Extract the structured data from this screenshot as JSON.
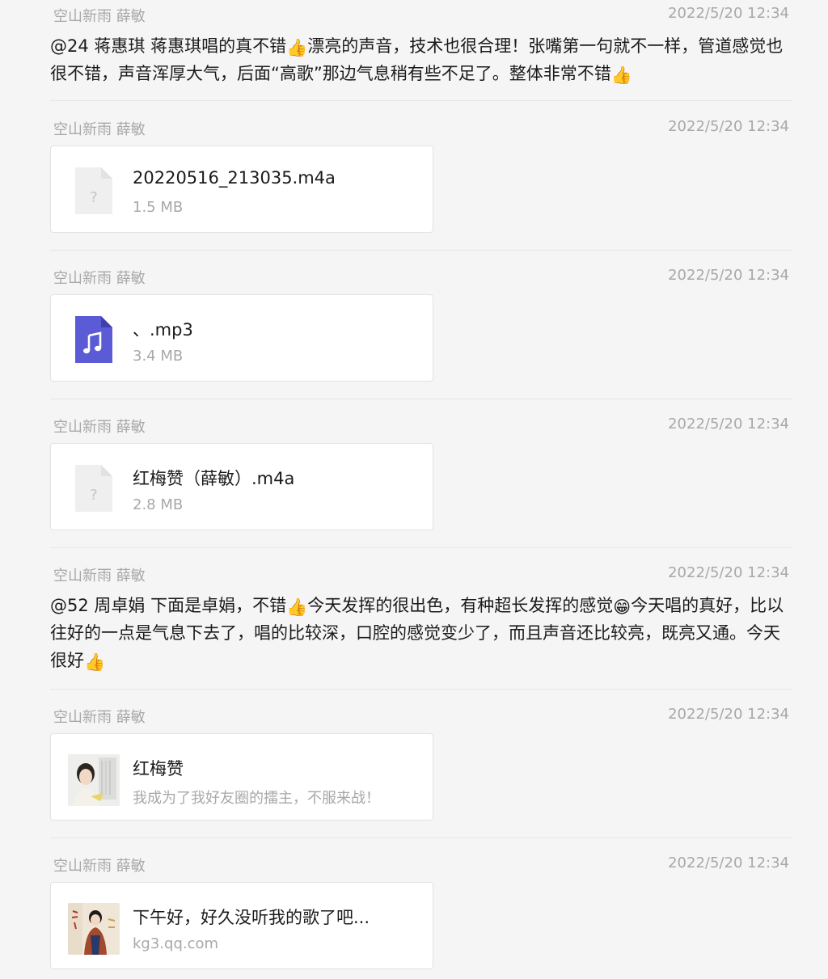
{
  "messages": [
    {
      "sender": "空山新雨 薛敏",
      "time": "2022/5/20 12:34",
      "text_parts": [
        "@24 蒋惠琪 蒋惠琪唱的真不错",
        "漂亮的声音，技术也很合理！张嘴第一句就不一样，管道感觉也很不错，声音浑厚大气，后面“高歌”那边气息稍有些不足了。整体非常不错"
      ],
      "emoji": "thumbs-up"
    },
    {
      "sender": "空山新雨 薛敏",
      "time": "2022/5/20 12:34",
      "file": {
        "name": "20220516_213035.m4a",
        "size": "1.5 MB",
        "icon": "unknown-file-icon"
      }
    },
    {
      "sender": "空山新雨 薛敏",
      "time": "2022/5/20 12:34",
      "file": {
        "name": "、.mp3",
        "size": "3.4 MB",
        "icon": "music-file-icon"
      }
    },
    {
      "sender": "空山新雨 薛敏",
      "time": "2022/5/20 12:34",
      "file": {
        "name": "红梅赞（薛敏）.m4a",
        "size": "2.8 MB",
        "icon": "unknown-file-icon"
      }
    },
    {
      "sender": "空山新雨 薛敏",
      "time": "2022/5/20 12:34",
      "text_parts": [
        "@52 周卓娟 下面是卓娟，不错",
        "今天发挥的很出色，有种超长发挥的感觉",
        "今天唱的真好，比以往好的一点是气息下去了，唱的比较深，口腔的感觉变少了，而且声音还比较亮，既亮又通。今天很好"
      ]
    },
    {
      "sender": "空山新雨 薛敏",
      "time": "2022/5/20 12:34",
      "link": {
        "title": "红梅赞",
        "subtitle": "我成为了我好友圈的擂主，不服来战！",
        "thumb": "singer-album-thumbnail"
      }
    },
    {
      "sender": "空山新雨 薛敏",
      "time": "2022/5/20 12:34",
      "link": {
        "title": "下午好，好久没听我的歌了吧...",
        "subtitle": "kg3.qq.com",
        "thumb": "singer-album-thumbnail"
      }
    }
  ],
  "colors": {
    "background": "#f5f5f5",
    "meta_text": "#a8a8a8",
    "music_icon": "#5b5bd6"
  }
}
